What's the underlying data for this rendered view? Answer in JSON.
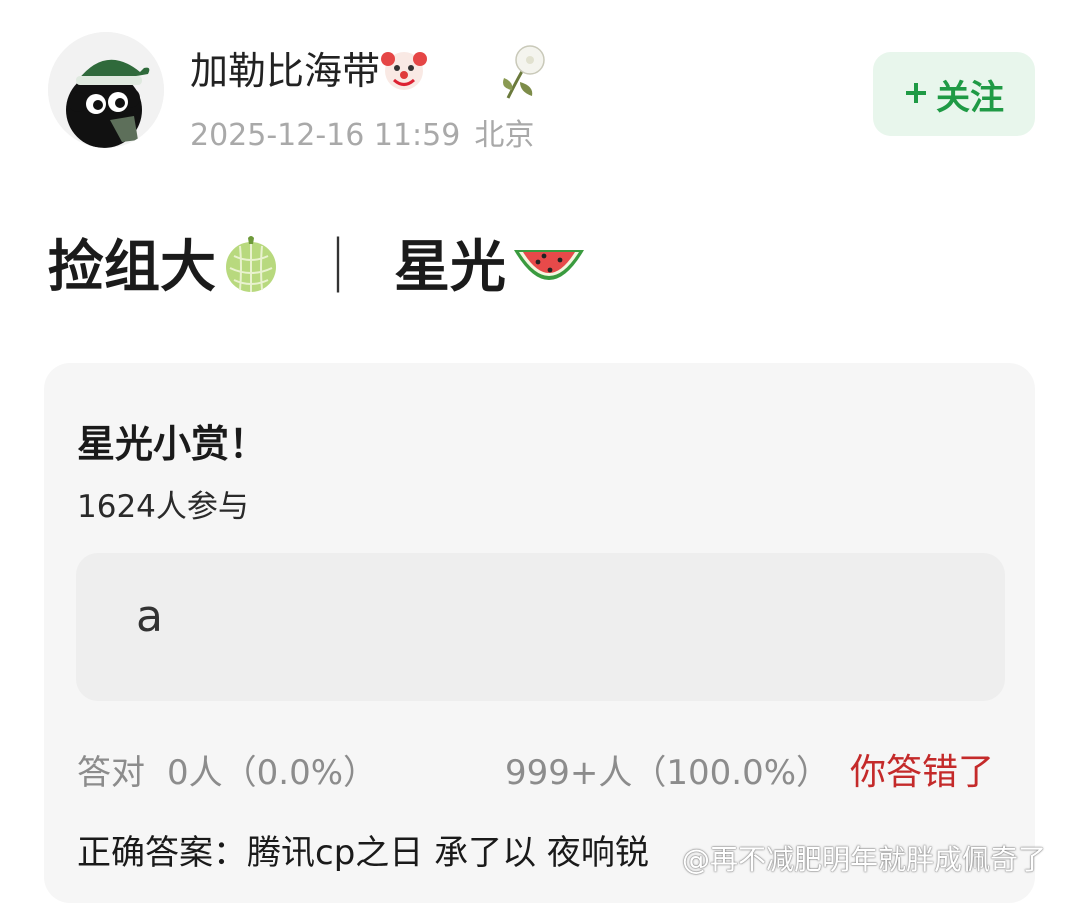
{
  "post": {
    "username": "加勒比海带",
    "timestamp": "2025-12-16 11:59",
    "location": "北京",
    "follow_label": "关注",
    "follow_icon": "plus",
    "title_left": "捡组大",
    "title_separator": "｜",
    "title_right": "星光"
  },
  "poll": {
    "title": "星光小赏！",
    "participants": "1624人参与",
    "option_label": "a",
    "correct_label": "答对",
    "correct_value": "0人（0.0%）",
    "option_votes": "999+人（100.0%）",
    "result_text": "你答错了",
    "answer_text": "正确答案：腾讯cp之日 承了以 夜响锐"
  },
  "watermark": "@再不减肥明年就胖成佩奇了",
  "colors": {
    "follow_bg": "#e8f6ec",
    "follow_text": "#1f9a45",
    "wrong_text": "#c42a2a",
    "meta_text": "#a9a9a9"
  }
}
